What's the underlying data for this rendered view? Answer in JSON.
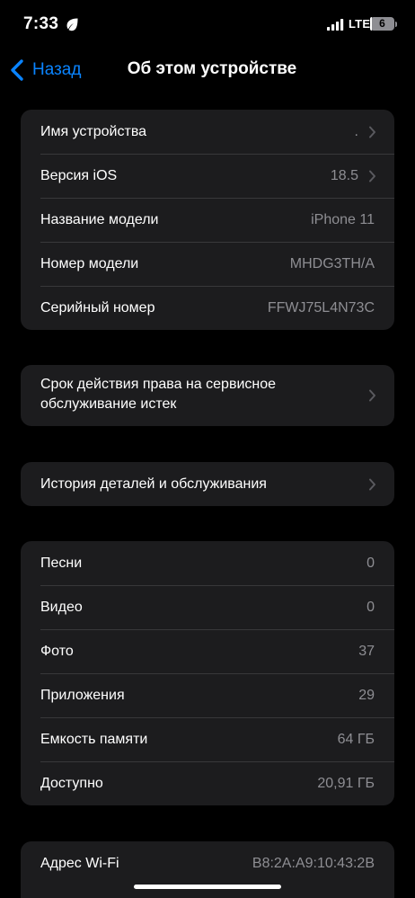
{
  "status_bar": {
    "time": "7:33",
    "network": "LTE",
    "battery_level": "6",
    "battery_fraction": 0.06
  },
  "nav": {
    "back_label": "Назад",
    "title": "Об этом устройстве"
  },
  "device_info": [
    {
      "label": "Имя устройства",
      "value": ".",
      "chevron": true
    },
    {
      "label": "Версия iOS",
      "value": "18.5",
      "chevron": true
    },
    {
      "label": "Название модели",
      "value": "iPhone 11",
      "chevron": false
    },
    {
      "label": "Номер модели",
      "value": "MHDG3TH/A",
      "chevron": false
    },
    {
      "label": "Серийный номер",
      "value": "FFWJ75L4N73C",
      "chevron": false
    }
  ],
  "coverage": {
    "line1": "Срок действия права на сервисное",
    "line2": "обслуживание истек"
  },
  "parts_history": {
    "label": "История деталей и обслуживания"
  },
  "media_stats": [
    {
      "label": "Песни",
      "value": "0"
    },
    {
      "label": "Видео",
      "value": "0"
    },
    {
      "label": "Фото",
      "value": "37"
    },
    {
      "label": "Приложения",
      "value": "29"
    },
    {
      "label": "Емкость памяти",
      "value": "64 ГБ"
    },
    {
      "label": "Доступно",
      "value": "20,91 ГБ"
    }
  ],
  "network": [
    {
      "label": "Адрес Wi-Fi",
      "value": "B8:2A:A9:10:43:2B"
    }
  ],
  "colors": {
    "background": "#000000",
    "cell": "#1c1c1e",
    "accent": "#0a84ff",
    "secondary_text": "#8e8e93"
  },
  "icons": [
    "leaf-icon",
    "signal-icon",
    "battery-icon",
    "back-chevron-icon",
    "chevron-right-icon"
  ]
}
